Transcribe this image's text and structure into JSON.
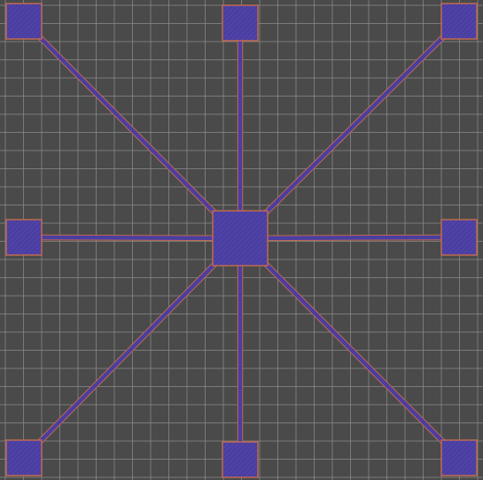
{
  "canvas": {
    "background_color": "#4a4a4a",
    "grid_line_color": "#8a8a8a"
  },
  "layout_view": {
    "center_pad": {
      "name": "hub-pad",
      "fill_color": "#4a3ea0",
      "edge_color": "#c06a4e"
    },
    "trace": {
      "fill_color": "#4a3ea0",
      "edge_color": "#c06a4e"
    },
    "outer_pads": [
      {
        "name": "pad-top-left"
      },
      {
        "name": "pad-top-center"
      },
      {
        "name": "pad-top-right"
      },
      {
        "name": "pad-middle-left"
      },
      {
        "name": "pad-middle-right"
      },
      {
        "name": "pad-bottom-left"
      },
      {
        "name": "pad-bottom-center"
      },
      {
        "name": "pad-bottom-right"
      }
    ]
  }
}
